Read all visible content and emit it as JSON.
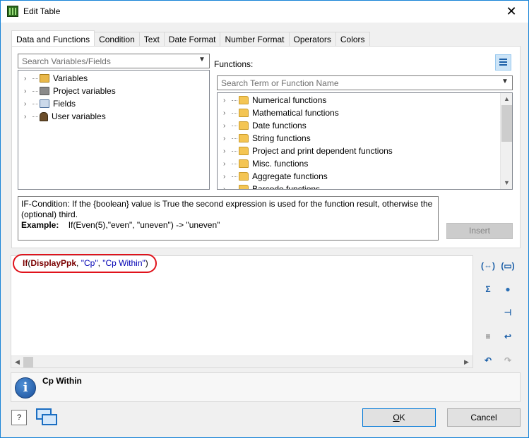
{
  "window": {
    "title": "Edit Table",
    "close_glyph": "✕"
  },
  "tabs": [
    {
      "label": "Data and Functions",
      "active": true
    },
    {
      "label": "Condition"
    },
    {
      "label": "Text"
    },
    {
      "label": "Date Format"
    },
    {
      "label": "Number Format"
    },
    {
      "label": "Operators"
    },
    {
      "label": "Colors"
    }
  ],
  "variables_panel": {
    "search_placeholder": "Search Variables/Fields",
    "items": [
      {
        "label": "Variables",
        "icon": "variables-icon"
      },
      {
        "label": "Project variables",
        "icon": "project-variables-icon"
      },
      {
        "label": "Fields",
        "icon": "fields-icon"
      },
      {
        "label": "User variables",
        "icon": "user-variables-icon"
      }
    ]
  },
  "functions_panel": {
    "label": "Functions:",
    "search_placeholder": "Search Term or Function Name",
    "items": [
      {
        "label": "Numerical functions"
      },
      {
        "label": "Mathematical functions"
      },
      {
        "label": "Date functions"
      },
      {
        "label": "String functions"
      },
      {
        "label": "Project and print dependent functions"
      },
      {
        "label": "Misc. functions"
      },
      {
        "label": "Aggregate functions"
      },
      {
        "label": "Barcode functions"
      }
    ]
  },
  "description": {
    "text": "IF-Condition: If the {boolean} value is True the second expression is used for the function result, otherwise the (optional) third.",
    "example_label": "Example:",
    "example_text": "If(Even(5),\"even\", \"uneven\") -> \"uneven\""
  },
  "insert_button": {
    "label": "Insert",
    "enabled": false
  },
  "expression": {
    "func": "If",
    "open": "(",
    "arg1": "DisplayPpk",
    "sep1": ", ",
    "arg2": "\"Cp\"",
    "sep2": ", ",
    "arg3": "\"Cp Within\"",
    "close": ")"
  },
  "result_panel": {
    "text": "Cp Within"
  },
  "footer": {
    "help_glyph": "?",
    "ok_label": "OK",
    "ok_mnemonic": "O",
    "cancel_label": "Cancel"
  },
  "colors": {
    "accent": "#1883d7",
    "highlight_ellipse": "#e0121b",
    "keyword": "#7a0000",
    "string": "#0000b4"
  }
}
